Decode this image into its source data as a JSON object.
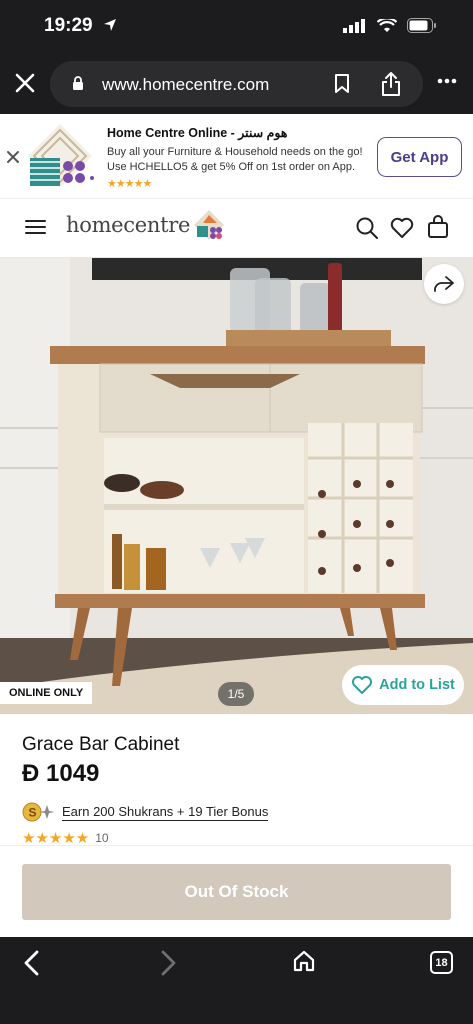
{
  "status": {
    "time": "19:29"
  },
  "browser": {
    "url": "www.homecentre.com"
  },
  "banner": {
    "title": "Home Centre Online - هوم سنتر",
    "line1": "Buy all your Furniture & Household needs on the go!",
    "line2": "Use HCHELLO5 & get 5% Off on 1st order on App.",
    "stars": "★★★★★",
    "cta": "Get App"
  },
  "header": {
    "brand": "homecentre"
  },
  "hero": {
    "badge": "ONLINE ONLY",
    "pager": "1/5",
    "add_to_list": "Add to List"
  },
  "product": {
    "name": "Grace Bar Cabinet",
    "price": "1049",
    "currency_symbol": "Đ",
    "shukran_text": "Earn 200 Shukrans + 19  Tier Bonus",
    "rating_stars": "★★★★★",
    "rating_count": "10"
  },
  "cta": {
    "out_of_stock": "Out Of Stock"
  },
  "toolbar": {
    "tabs_count": "18"
  },
  "colors": {
    "accent": "#2aa39a",
    "oos": "#d2c8bb",
    "get_app": "#4a3d8a",
    "star": "#f5a623"
  }
}
